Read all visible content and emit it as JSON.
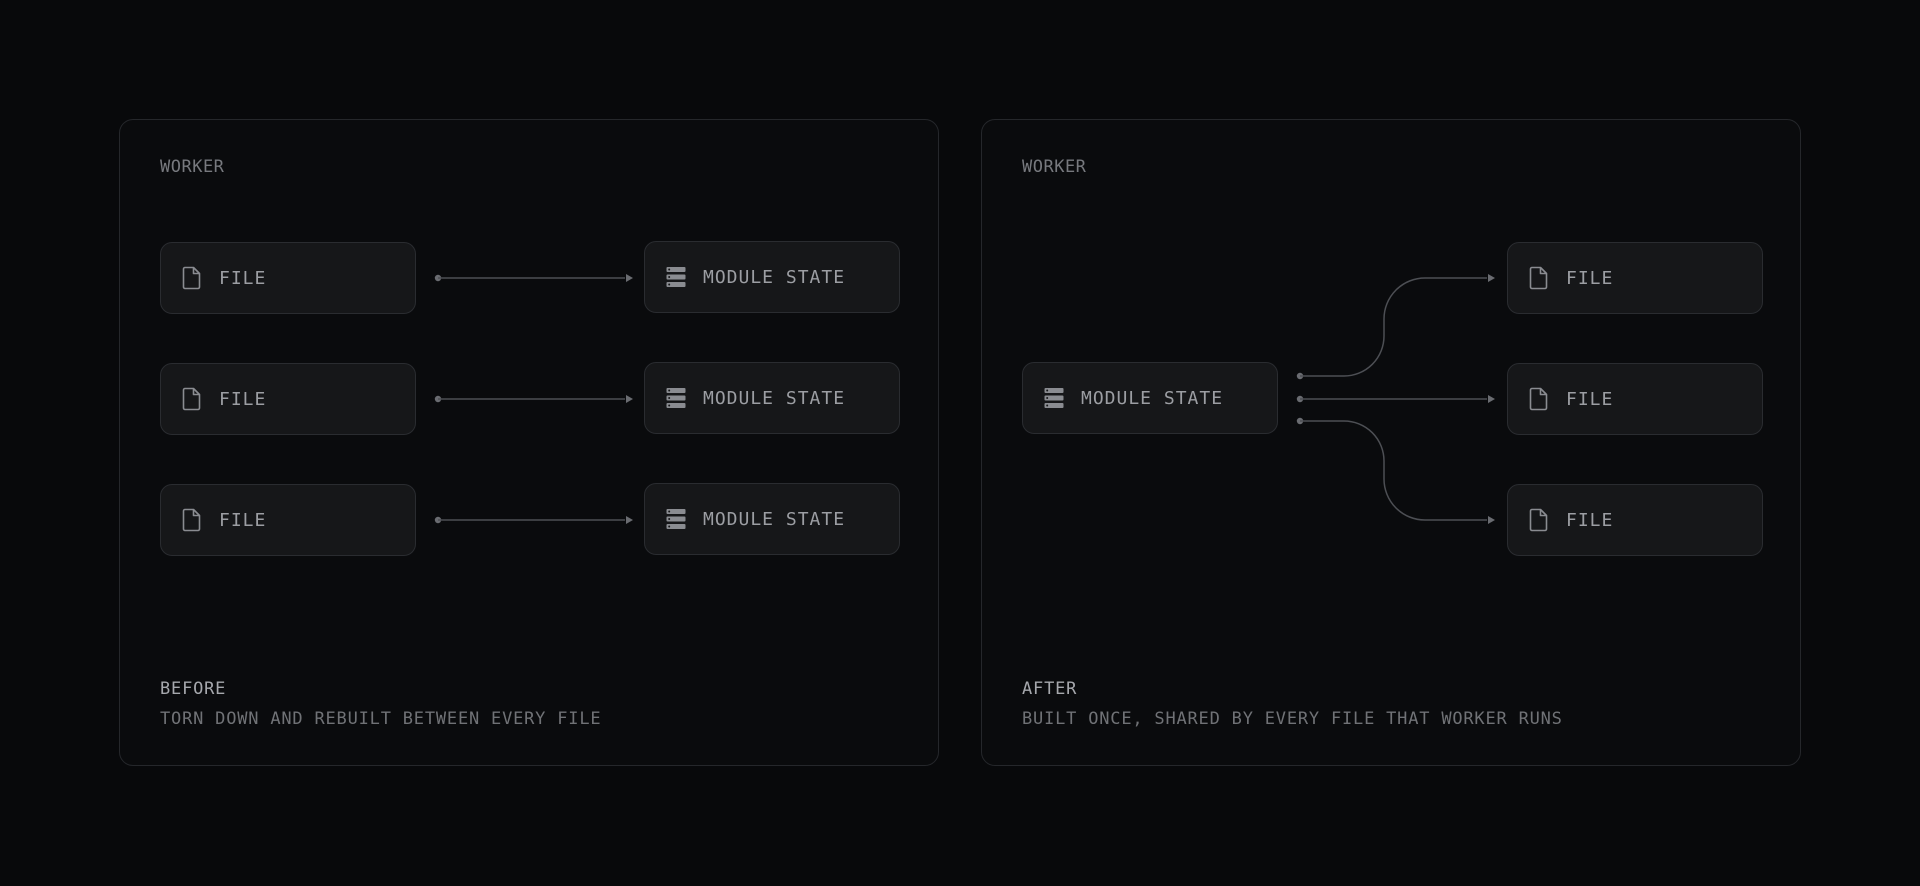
{
  "before": {
    "worker_label": "WORKER",
    "rows": [
      {
        "source": {
          "label": "FILE",
          "icon": "file-icon"
        },
        "target": {
          "label": "MODULE STATE",
          "icon": "server-stack-icon"
        }
      },
      {
        "source": {
          "label": "FILE",
          "icon": "file-icon"
        },
        "target": {
          "label": "MODULE STATE",
          "icon": "server-stack-icon"
        }
      },
      {
        "source": {
          "label": "FILE",
          "icon": "file-icon"
        },
        "target": {
          "label": "MODULE STATE",
          "icon": "server-stack-icon"
        }
      }
    ],
    "caption_title": "BEFORE",
    "caption_sub": "TORN DOWN AND REBUILT BETWEEN EVERY FILE"
  },
  "after": {
    "worker_label": "WORKER",
    "source": {
      "label": "MODULE STATE",
      "icon": "server-stack-icon"
    },
    "targets": [
      {
        "label": "FILE",
        "icon": "file-icon"
      },
      {
        "label": "FILE",
        "icon": "file-icon"
      },
      {
        "label": "FILE",
        "icon": "file-icon"
      }
    ],
    "caption_title": "AFTER",
    "caption_sub": "BUILT ONCE, SHARED BY EVERY FILE THAT WORKER RUNS"
  },
  "colors": {
    "background": "#08090b",
    "panel_border": "#25272b",
    "node_fill": "#161719",
    "node_border": "#2a2c30",
    "connector": "#5a5c61",
    "label_text": "#9c9ea3"
  }
}
